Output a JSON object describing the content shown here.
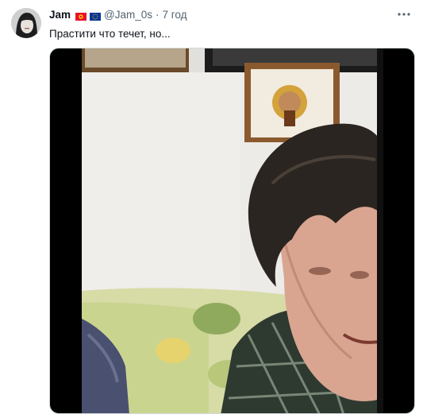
{
  "tweet": {
    "display_name": "Jam",
    "flags": [
      "kyrgyzstan-flag-icon",
      "eu-flag-icon"
    ],
    "handle": "@Jam_0s",
    "separator": "·",
    "time": "7 год",
    "text": "Прастити что течет, но...",
    "more_icon": "more-horizontal-icon"
  },
  "colors": {
    "secondary_text": "#536471",
    "primary_text": "#0f1419",
    "media_letterbox": "#000000"
  }
}
